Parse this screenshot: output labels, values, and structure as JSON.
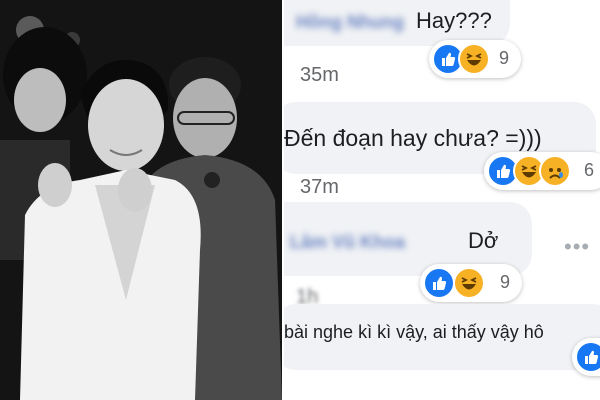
{
  "comments": [
    {
      "author": "Hồng Nhung",
      "text": "Hay???",
      "time": "35m",
      "reaction_count": "9",
      "reactions": [
        "like-icon",
        "haha-icon"
      ]
    },
    {
      "author": "",
      "text": "Đến đoạn hay chưa? =)))",
      "time": "37m",
      "reaction_count": "6",
      "reactions": [
        "like-icon",
        "haha-icon",
        "sad-icon"
      ]
    },
    {
      "author": "Lâm Vũ Khoa",
      "text": "Dở",
      "time": "1h",
      "reaction_count": "9",
      "reactions": [
        "like-icon",
        "haha-icon"
      ]
    },
    {
      "author": "",
      "text": "bài nghe kì kì vậy, ai thấy vậy hô",
      "reactions": [
        "like-icon"
      ]
    }
  ],
  "colors": {
    "like": "#1877f2",
    "haha": "#f7b125",
    "bubble": "#f0f2f5",
    "name": "#6b84c2"
  }
}
